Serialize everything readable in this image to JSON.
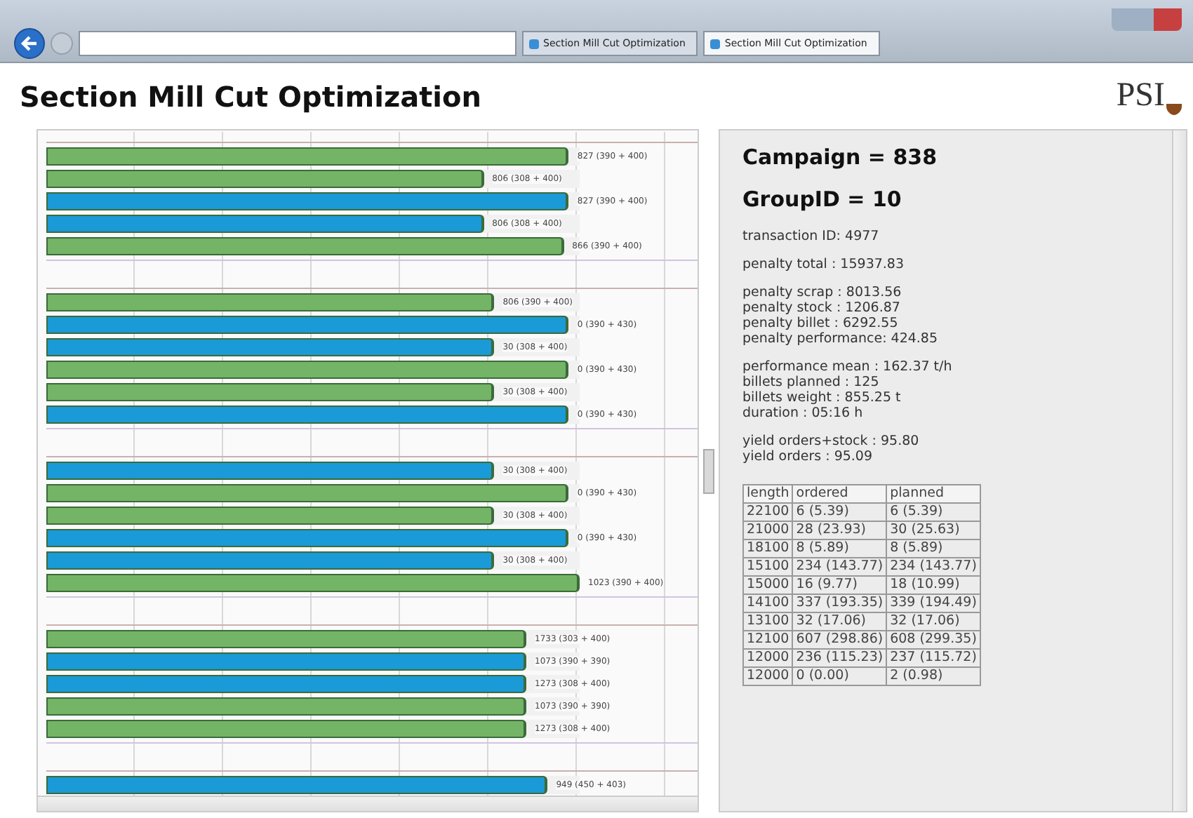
{
  "browser": {
    "tabs": [
      {
        "title": "Section Mill Cut Optimization",
        "selected": false
      },
      {
        "title": "Section Mill Cut Optimization",
        "selected": true
      }
    ]
  },
  "page": {
    "title": "Section Mill Cut Optimization",
    "logo": "PSI"
  },
  "groups": [
    {
      "bars": [
        {
          "level": 0.98,
          "color": "#74b466",
          "label": "827 (390 + 400)"
        },
        {
          "level": 0.82,
          "color": "#74b466",
          "label": "806 (308 + 400)"
        },
        {
          "level": 0.98,
          "color": "#1a9ad6",
          "label": "827 (390 + 400)"
        },
        {
          "level": 0.82,
          "color": "#1a9ad6",
          "label": "806 (308 + 400)"
        },
        {
          "level": 0.97,
          "color": "#74b466",
          "label": "866 (390 + 400)"
        }
      ]
    },
    {
      "bars": [
        {
          "level": 0.84,
          "color": "#74b466",
          "label": "806 (390 + 400)"
        },
        {
          "level": 0.98,
          "color": "#1a9ad6",
          "label": "0 (390 + 430)"
        },
        {
          "level": 0.84,
          "color": "#1a9ad6",
          "label": "30 (308 + 400)"
        },
        {
          "level": 0.98,
          "color": "#74b466",
          "label": "0 (390 + 430)"
        },
        {
          "level": 0.84,
          "color": "#74b466",
          "label": "30 (308 + 400)"
        },
        {
          "level": 0.98,
          "color": "#1a9ad6",
          "label": "0 (390 + 430)"
        }
      ]
    },
    {
      "bars": [
        {
          "level": 0.84,
          "color": "#1a9ad6",
          "label": "30 (308 + 400)"
        },
        {
          "level": 0.98,
          "color": "#74b466",
          "label": "0 (390 + 430)"
        },
        {
          "level": 0.84,
          "color": "#74b466",
          "label": "30 (308 + 400)"
        },
        {
          "level": 0.98,
          "color": "#1a9ad6",
          "label": "0 (390 + 430)"
        },
        {
          "level": 0.84,
          "color": "#1a9ad6",
          "label": "30 (308 + 400)"
        },
        {
          "level": 1.0,
          "color": "#74b466",
          "label": "1023 (390 + 400)"
        }
      ]
    },
    {
      "bars": [
        {
          "level": 0.9,
          "color": "#74b466",
          "label": "1733 (303 + 400)"
        },
        {
          "level": 0.9,
          "color": "#1a9ad6",
          "label": "1073 (390 + 390)"
        },
        {
          "level": 0.9,
          "color": "#1a9ad6",
          "label": "1273 (308 + 400)"
        },
        {
          "level": 0.9,
          "color": "#74b466",
          "label": "1073 (390 + 390)"
        },
        {
          "level": 0.9,
          "color": "#74b466",
          "label": "1273 (308 + 400)"
        }
      ]
    },
    {
      "bars": [
        {
          "level": 0.94,
          "color": "#1a9ad6",
          "label": "949 (450 + 403)"
        }
      ]
    }
  ],
  "summary": {
    "campaign": "Campaign = 838",
    "group_id": "GroupID = 10",
    "sections": [
      [
        "transaction ID: 4977"
      ],
      [
        "penalty total : 15937.83"
      ],
      [
        "penalty scrap : 8013.56",
        "penalty stock : 1206.87",
        "penalty billet : 6292.55",
        "penalty performance: 424.85"
      ],
      [
        "performance mean : 162.37 t/h",
        "billets planned : 125",
        "billets weight : 855.25 t",
        "duration : 05:16 h"
      ],
      [
        "yield orders+stock : 95.80",
        "yield orders : 95.09"
      ]
    ]
  },
  "table": {
    "columns": [
      "length",
      "ordered",
      "planned"
    ],
    "rows": [
      [
        "22100",
        "6 (5.39)",
        "6 (5.39)"
      ],
      [
        "21000",
        "28 (23.93)",
        "30 (25.63)"
      ],
      [
        "18100",
        "8 (5.89)",
        "8 (5.89)"
      ],
      [
        "15100",
        "234 (143.77)",
        "234 (143.77)"
      ],
      [
        "15000",
        "16 (9.77)",
        "18 (10.99)"
      ],
      [
        "14100",
        "337 (193.35)",
        "339 (194.49)"
      ],
      [
        "13100",
        "32 (17.06)",
        "32 (17.06)"
      ],
      [
        "12100",
        "607 (298.86)",
        "608 (299.35)"
      ],
      [
        "12000",
        "236 (115.23)",
        "237 (115.72)"
      ],
      [
        "12000",
        "0 (0.00)",
        "2 (0.98)"
      ]
    ]
  }
}
